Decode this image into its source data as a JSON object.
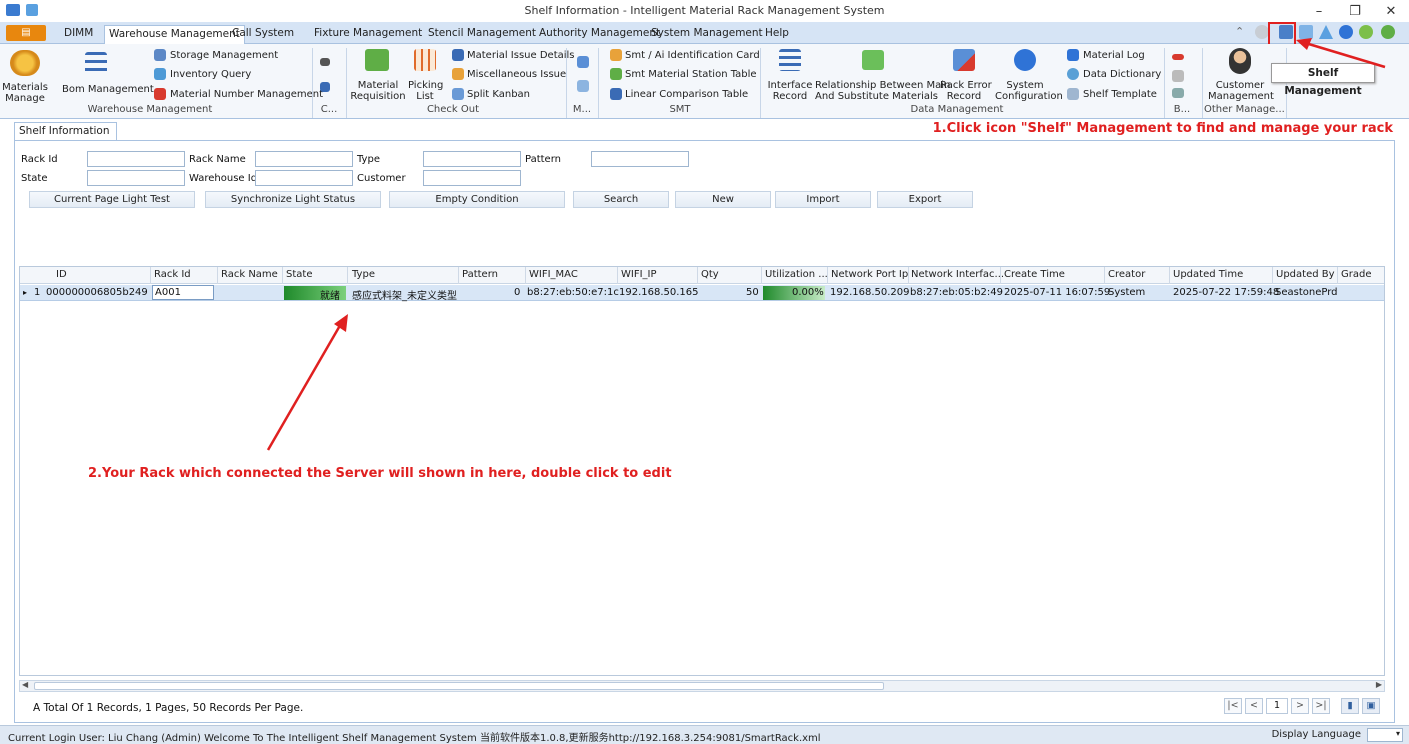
{
  "window": {
    "title": "Shelf Information - Intelligent Material Rack Management System",
    "minimize": "–",
    "restore": "❐",
    "close": "✕"
  },
  "menu": {
    "file_label": "",
    "tabs": [
      "DIMM",
      "Warehouse Management",
      "Call System",
      "Fixture Management",
      "Stencil Management",
      "Authority Management",
      "System Management",
      "Help"
    ],
    "active_tab": "Warehouse Management"
  },
  "ribbon": {
    "materials_manage": "Materials\nManage",
    "bom_management": "Bom Management",
    "storage_management": "Storage Management",
    "inventory_query": "Inventory Query",
    "material_number_management": "Material Number Management",
    "material_requisition": "Material\nRequisition",
    "picking_list": "Picking\nList",
    "material_issue_details": "Material Issue Details",
    "miscellaneous_issue": "Miscellaneous Issue",
    "split_kanban": "Split Kanban",
    "smt_ai_card": "Smt / Ai Identification Card",
    "smt_station_table": "Smt Material Station Table",
    "linear_comparison_table": "Linear Comparison Table",
    "interface_record": "Interface\nRecord",
    "relationship": "Relationship Between Main\nAnd Substitute Materials",
    "rack_error_record": "Rack Error\nRecord",
    "system_configuration": "System\nConfiguration",
    "material_log": "Material Log",
    "data_dictionary": "Data Dictionary",
    "shelf_template": "Shelf Template",
    "customer_management": "Customer\nManagement",
    "groups": {
      "warehouse_management": "Warehouse Management",
      "c": "C...",
      "check_out": "Check Out",
      "m": "M...",
      "smt": "SMT",
      "data_management": "Data Management",
      "b": "B...",
      "other_management": "Other Manage..."
    }
  },
  "tooltip": "Shelf Management",
  "doc_tab": {
    "label": "Shelf Information",
    "close": "✕"
  },
  "instruction_1": "1.Click icon \"Shelf\" Management to find and manage your rack",
  "instruction_2": "2.Your Rack which connected the Server will shown in here, double click to edit",
  "filters": {
    "rack_id": "Rack Id",
    "rack_name": "Rack Name",
    "type": "Type",
    "pattern": "Pattern",
    "state": "State",
    "warehouse_id": "Warehouse Id",
    "customer": "Customer"
  },
  "buttons": [
    "Current Page Light Test",
    "Synchronize Light Status",
    "Empty Condition",
    "Search",
    "New",
    "Import",
    "Export"
  ],
  "grid": {
    "columns": [
      "ID",
      "Rack Id",
      "Rack Name",
      "State",
      "Type",
      "Pattern",
      "WIFI_MAC",
      "WIFI_IP",
      "Qty",
      "Utilization ...",
      "Network Port Ip",
      "Network Interfac...",
      "Create Time",
      "Creator",
      "Updated Time",
      "Updated By",
      "Grade"
    ],
    "rows": [
      {
        "num": "1",
        "id": "000000006805b249",
        "rack_id": "A001",
        "rack_name": "",
        "state": "就绪",
        "type": "感应式料架_未定义类型",
        "pattern": "0",
        "wifi_mac": "b8:27:eb:50:e7:1c",
        "wifi_ip": "192.168.50.165",
        "qty": "50",
        "utilization": "0.00%",
        "network_port_ip": "192.168.50.209",
        "network_interface": "b8:27:eb:05:b2:49",
        "create_time": "2025-07-11 16:07:59",
        "creator": "System",
        "updated_time": "2025-07-22 17:59:48",
        "updated_by": "SeastonePrd",
        "grade": ""
      }
    ]
  },
  "footer": {
    "records": "A Total Of 1 Records, 1 Pages, 50 Records Per Page.",
    "pager": [
      "|<",
      "<",
      "1",
      ">",
      ">|"
    ]
  },
  "status": {
    "text": "Current Login User: Liu Chang (Admin)  Welcome To The Intelligent Shelf Management System  当前软件版本1.0.8,更新服务http://192.168.3.254:9081/SmartRack.xml",
    "display_language": "Display Language"
  },
  "colors": {
    "accent_red": "#e02020",
    "state_green": "#2e9e3a",
    "ribbon_bg": "#f4f7fb",
    "menu_bg": "#d6e4f5"
  }
}
